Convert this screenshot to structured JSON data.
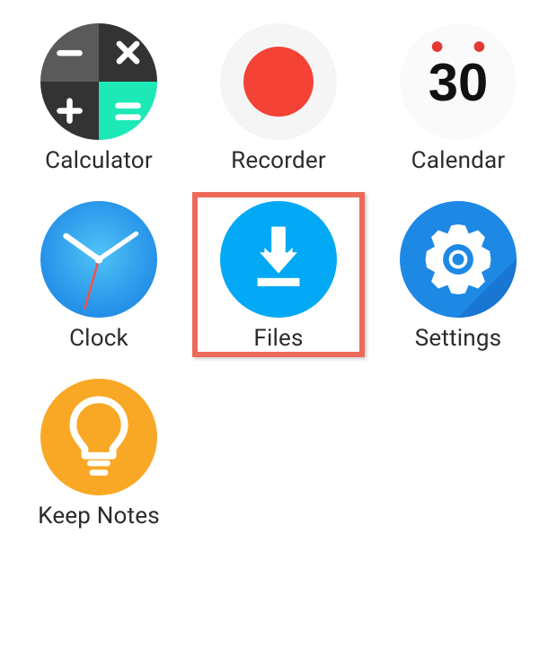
{
  "apps": [
    {
      "id": "calculator",
      "label": "Calculator",
      "icon": "calculator-icon"
    },
    {
      "id": "recorder",
      "label": "Recorder",
      "icon": "recorder-icon"
    },
    {
      "id": "calendar",
      "label": "Calendar",
      "icon": "calendar-icon",
      "date": "30"
    },
    {
      "id": "clock",
      "label": "Clock",
      "icon": "clock-icon"
    },
    {
      "id": "files",
      "label": "Files",
      "icon": "files-icon",
      "highlighted": true
    },
    {
      "id": "settings",
      "label": "Settings",
      "icon": "settings-icon"
    },
    {
      "id": "keepnotes",
      "label": "Keep Notes",
      "icon": "keep-notes-icon"
    }
  ],
  "colors": {
    "highlight": "#ed6a5a",
    "files_blue": "#03a9f4",
    "settings_blue": "#1e88e5",
    "clock_blue": "#1e88e5",
    "recorder_red": "#f44336",
    "keep_yellow": "#f9a825",
    "calc_dark": "#424242",
    "calc_darker": "#2f2f2f",
    "calc_teal": "#1de9b6",
    "calendar_red": "#e53935"
  }
}
